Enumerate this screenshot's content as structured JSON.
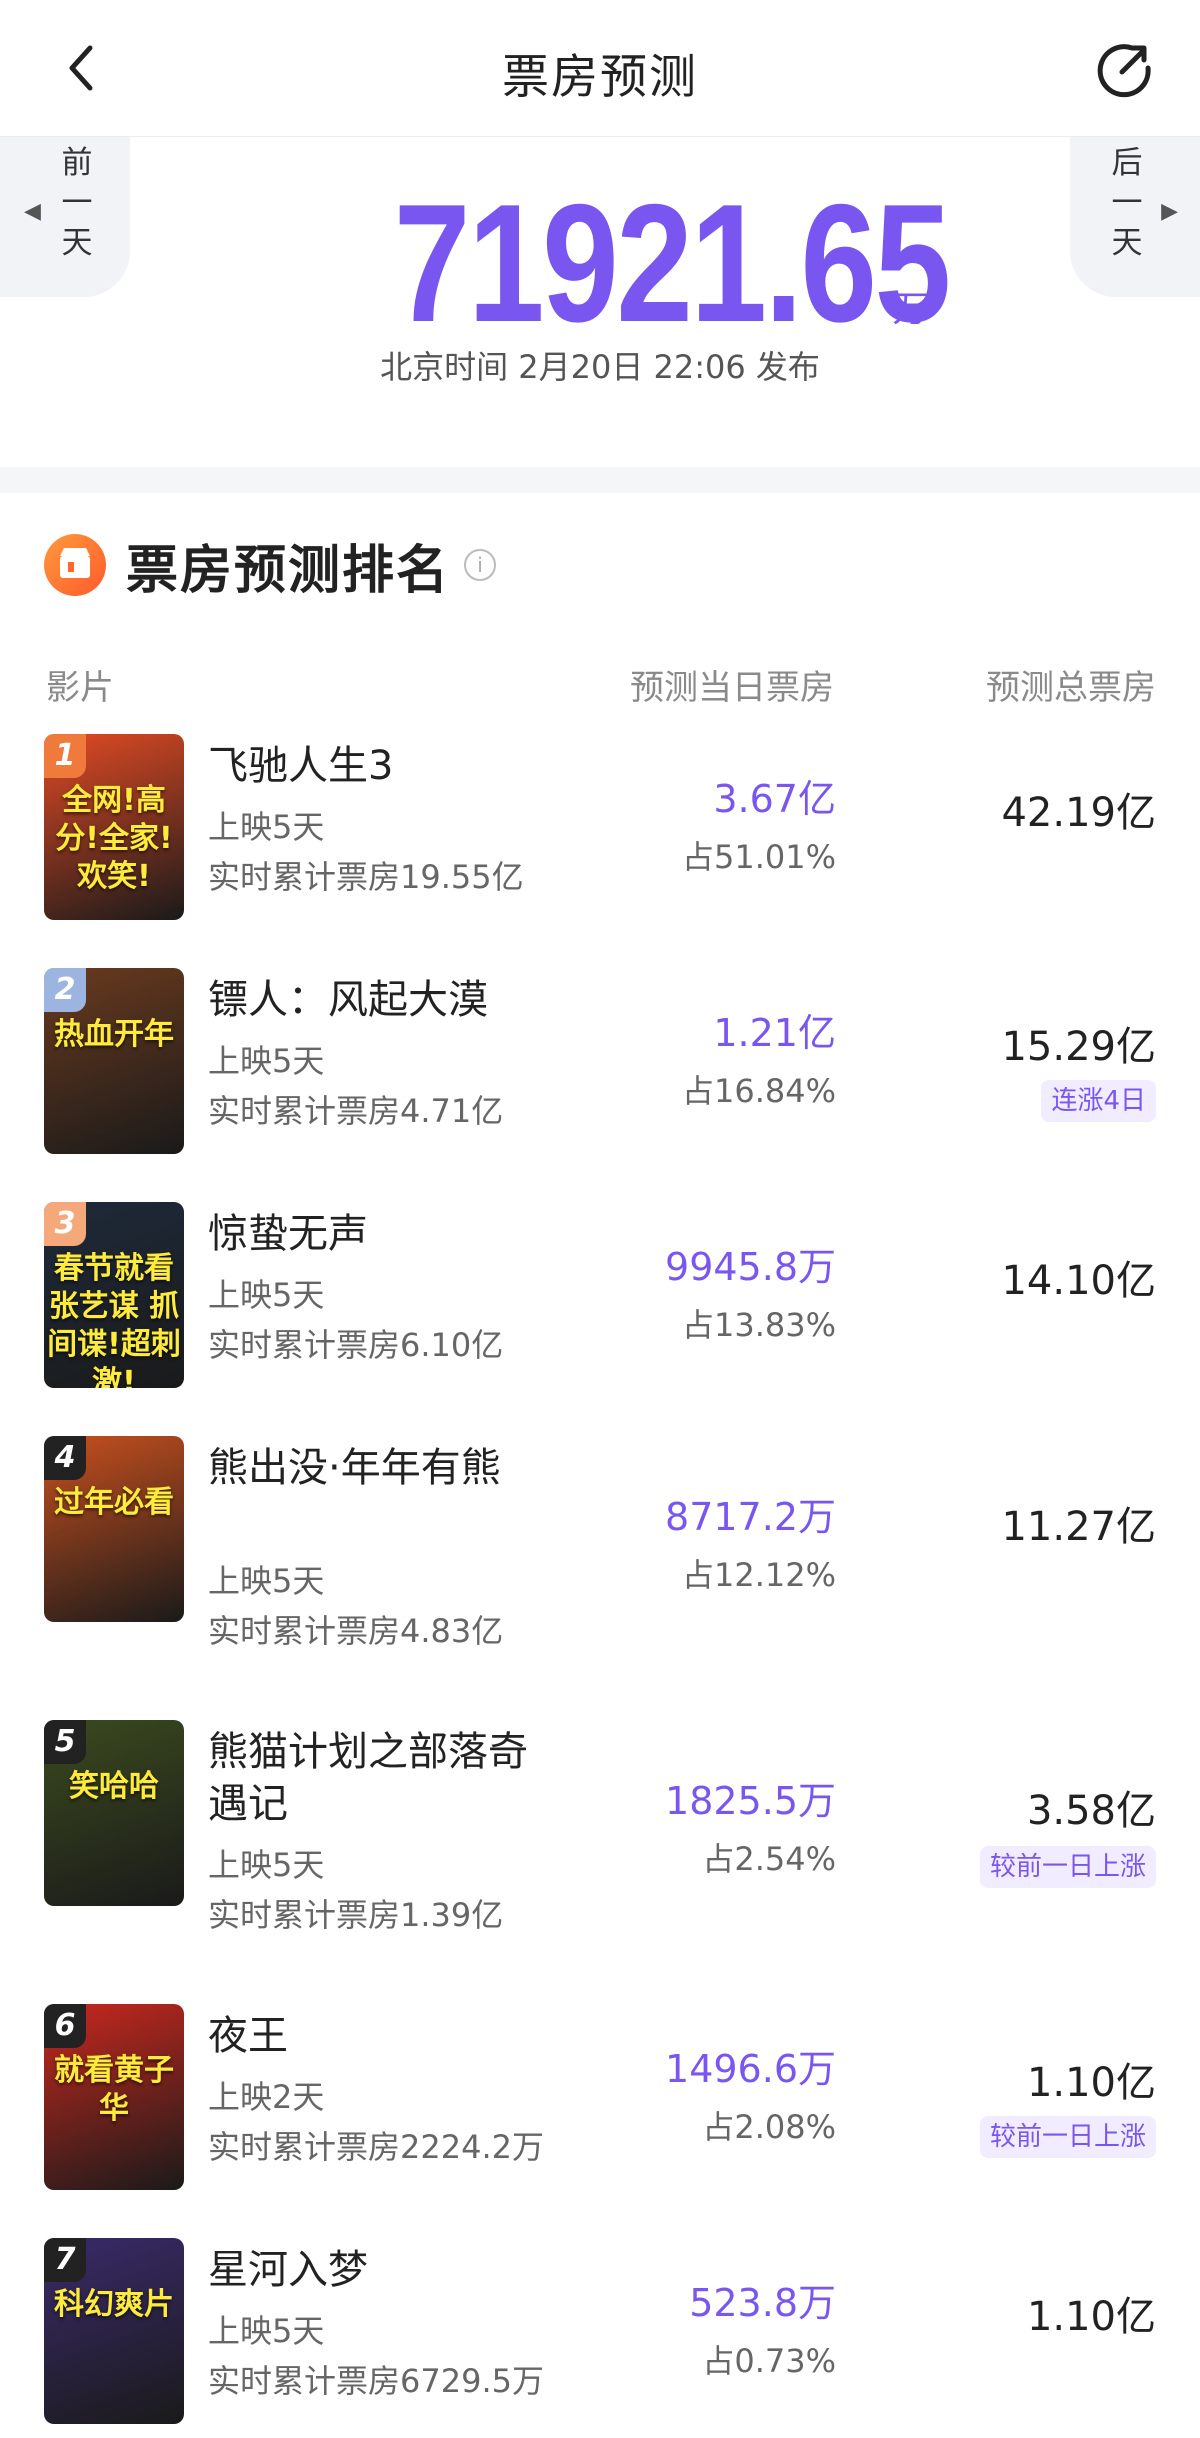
{
  "nav": {
    "title": "票房预测"
  },
  "summary": {
    "prev_day": [
      "前",
      "一",
      "天"
    ],
    "next_day": [
      "后",
      "一",
      "天"
    ],
    "total": "71921.65",
    "unit": "万",
    "publish_time": "北京时间 2月20日 22:06 发布"
  },
  "ranking": {
    "title": "票房预测排名",
    "col_movie": "影片",
    "col_daily": "预测当日票房",
    "col_total": "预测总票房",
    "rows": [
      {
        "rank": "1",
        "title": "飞驰人生3",
        "days": "上映5天",
        "cumulative": "实时累计票房19.55亿",
        "daily": "3.67亿",
        "share": "占51.01%",
        "total": "42.19亿",
        "tag": "",
        "poster_text": "全网!高分!全家!欢笑!",
        "badge_color": "#f07a3b",
        "poster_color": "#e24a24"
      },
      {
        "rank": "2",
        "title": "镖人：风起大漠",
        "days": "上映5天",
        "cumulative": "实时累计票房4.71亿",
        "daily": "1.21亿",
        "share": "占16.84%",
        "total": "15.29亿",
        "tag": "连涨4日",
        "poster_text": "热血开年",
        "badge_color": "#9db4e0",
        "poster_color": "#6a3a1e"
      },
      {
        "rank": "3",
        "title": "惊蛰无声",
        "days": "上映5天",
        "cumulative": "实时累计票房6.10亿",
        "daily": "9945.8万",
        "share": "占13.83%",
        "total": "14.10亿",
        "tag": "",
        "poster_text": "春节就看张艺谋 抓间谍!超刺激!",
        "badge_color": "#f5a97a",
        "poster_color": "#1e2a3a"
      },
      {
        "rank": "4",
        "title": "熊出没·年年有熊",
        "days": "上映5天",
        "cumulative": "实时累计票房4.83亿",
        "daily": "8717.2万",
        "share": "占12.12%",
        "total": "11.27亿",
        "tag": "",
        "poster_text": "过年必看",
        "badge_color": "#222222",
        "poster_color": "#c8501e"
      },
      {
        "rank": "5",
        "title": "熊猫计划之部落奇遇记",
        "days": "上映5天",
        "cumulative": "实时累计票房1.39亿",
        "daily": "1825.5万",
        "share": "占2.54%",
        "total": "3.58亿",
        "tag": "较前一日上涨",
        "poster_text": "笑哈哈",
        "badge_color": "#222222",
        "poster_color": "#3b4a1e"
      },
      {
        "rank": "6",
        "title": "夜王",
        "days": "上映2天",
        "cumulative": "实时累计票房2224.2万",
        "daily": "1496.6万",
        "share": "占2.08%",
        "total": "1.10亿",
        "tag": "较前一日上涨",
        "poster_text": "就看黄子华",
        "badge_color": "#222222",
        "poster_color": "#c8281e"
      },
      {
        "rank": "7",
        "title": "星河入梦",
        "days": "上映5天",
        "cumulative": "实时累计票房6729.5万",
        "daily": "523.8万",
        "share": "占0.73%",
        "total": "1.10亿",
        "tag": "",
        "poster_text": "科幻爽片",
        "badge_color": "#222222",
        "poster_color": "#3a2a6a"
      }
    ]
  }
}
